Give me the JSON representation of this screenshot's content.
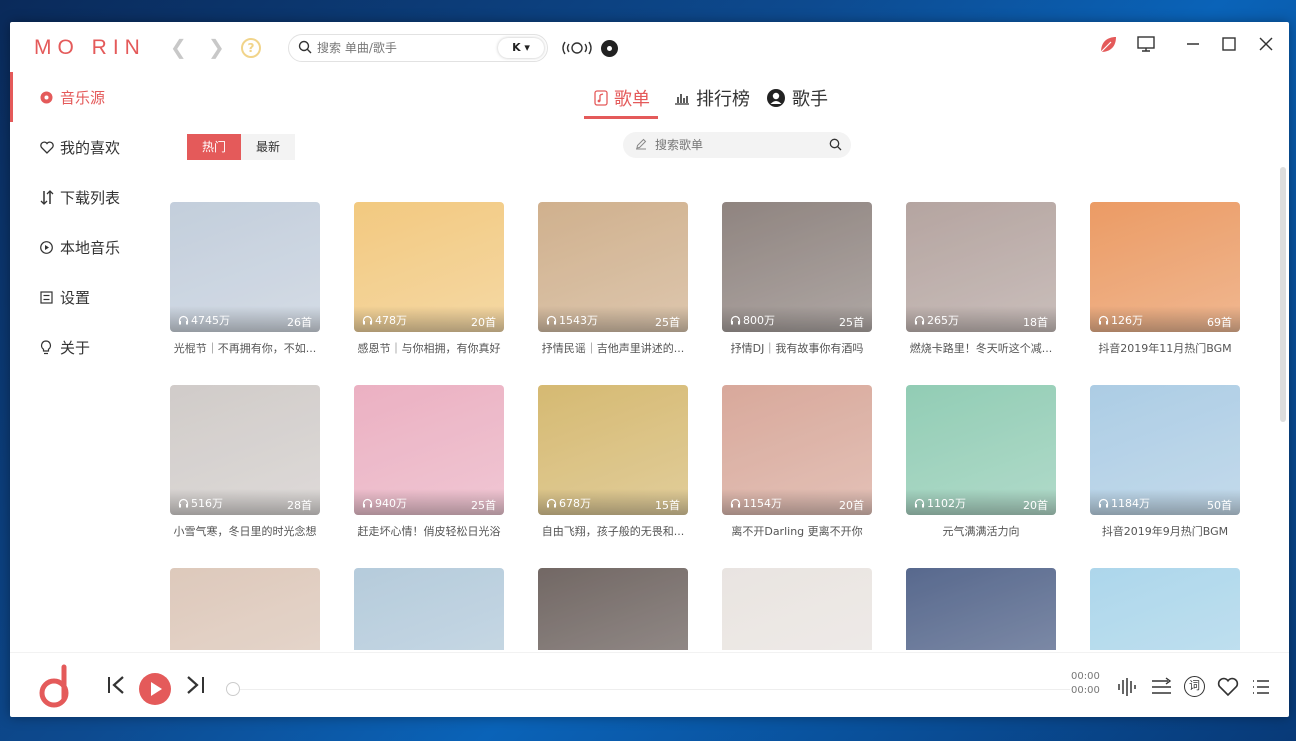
{
  "app": {
    "logo": "MO RIN"
  },
  "topbar": {
    "search_placeholder": "搜索 单曲/歌手",
    "engine_label": "K ▾"
  },
  "sidebar": {
    "items": [
      {
        "label": "音乐源",
        "icon": "record-icon"
      },
      {
        "label": "我的喜欢",
        "icon": "heart-icon"
      },
      {
        "label": "下载列表",
        "icon": "sort-arrows-icon"
      },
      {
        "label": "本地音乐",
        "icon": "play-circle-icon"
      },
      {
        "label": "设置",
        "icon": "settings-icon"
      },
      {
        "label": "关于",
        "icon": "bulb-icon"
      }
    ]
  },
  "tabs": [
    {
      "label": "歌单",
      "icon": "playlist-icon"
    },
    {
      "label": "排行榜",
      "icon": "bar-chart-icon"
    },
    {
      "label": "歌手",
      "icon": "person-icon"
    }
  ],
  "filters": {
    "hot": "热门",
    "new": "最新"
  },
  "list_search": {
    "placeholder": "搜索歌单"
  },
  "playlists": [
    {
      "title": "光棍节｜不再拥有你，不如...",
      "plays": "4745万",
      "tracks": "26首",
      "color": "#b9c6d6"
    },
    {
      "title": "感恩节｜与你相拥，有你真好",
      "plays": "478万",
      "tracks": "20首",
      "color": "#f0c06a"
    },
    {
      "title": "抒情民谣｜吉他声里讲述的...",
      "plays": "1543万",
      "tracks": "25首",
      "color": "#c8a37a"
    },
    {
      "title": "抒情DJ｜我有故事你有酒吗",
      "plays": "800万",
      "tracks": "25首",
      "color": "#7c6f6a"
    },
    {
      "title": "燃烧卡路里！冬天听这个减...",
      "plays": "265万",
      "tracks": "18首",
      "color": "#a89590"
    },
    {
      "title": "抖音2019年11月热门BGM",
      "plays": "126万",
      "tracks": "69首",
      "color": "#e88a4a"
    },
    {
      "title": "小雪气寒，冬日里的时光念想",
      "plays": "516万",
      "tracks": "28首",
      "color": "#c9c3c0"
    },
    {
      "title": "赶走坏心情！俏皮轻松日光浴",
      "plays": "940万",
      "tracks": "25首",
      "color": "#e8a3b8"
    },
    {
      "title": "自由飞翔，孩子般的无畏和...",
      "plays": "678万",
      "tracks": "15首",
      "color": "#cfae5a"
    },
    {
      "title": "离不开Darling 更离不开你",
      "plays": "1154万",
      "tracks": "20首",
      "color": "#d29a8a"
    },
    {
      "title": "元气满满活力向",
      "plays": "1102万",
      "tracks": "20首",
      "color": "#7fc4a8"
    },
    {
      "title": "抖音2019年9月热门BGM",
      "plays": "1184万",
      "tracks": "50首",
      "color": "#9ec4e0"
    },
    {
      "title": "",
      "plays": "",
      "tracks": "",
      "color": "#d8c0b0"
    },
    {
      "title": "",
      "plays": "",
      "tracks": "",
      "color": "#a9c3d6"
    },
    {
      "title": "",
      "plays": "",
      "tracks": "",
      "color": "#5a4e4a"
    },
    {
      "title": "",
      "plays": "",
      "tracks": "",
      "color": "#e6e0dc"
    },
    {
      "title": "",
      "plays": "",
      "tracks": "",
      "color": "#3b4f7a"
    },
    {
      "title": "",
      "plays": "",
      "tracks": "",
      "color": "#9fd0e8"
    }
  ],
  "player": {
    "time_current": "00:00",
    "time_total": "00:00",
    "lyric_label": "词",
    "progress": 0
  },
  "colors": {
    "accent": "#e45a5a"
  }
}
